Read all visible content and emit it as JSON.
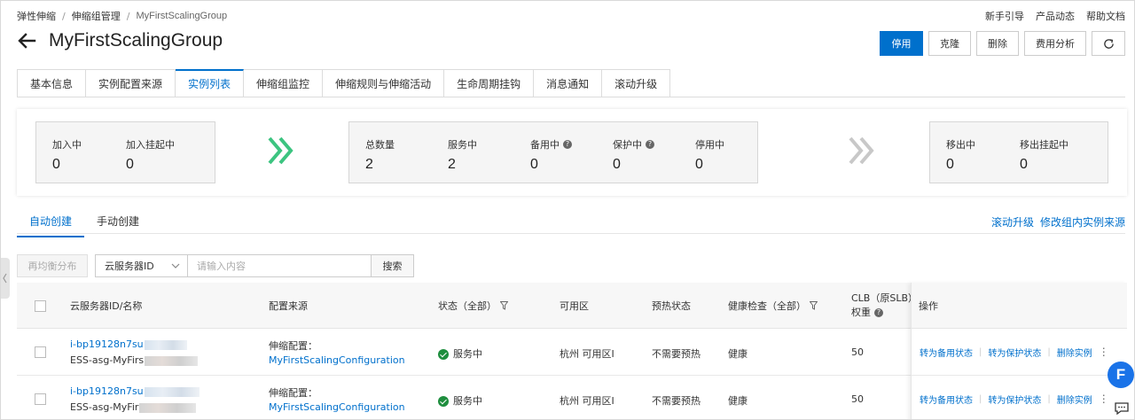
{
  "breadcrumb": [
    "弹性伸缩",
    "伸缩组管理",
    "MyFirstScalingGroup"
  ],
  "top_links": [
    "新手引导",
    "产品动态",
    "帮助文档"
  ],
  "title": "MyFirstScalingGroup",
  "actions": {
    "disable": "停用",
    "clone": "克隆",
    "delete": "删除",
    "cost": "费用分析"
  },
  "tabs": [
    "基本信息",
    "实例配置来源",
    "实例列表",
    "伸缩组监控",
    "伸缩规则与伸缩活动",
    "生命周期挂钩",
    "消息通知",
    "滚动升级"
  ],
  "active_tab": "实例列表",
  "status": {
    "joining": {
      "label": "加入中",
      "value": "0"
    },
    "joining_pending": {
      "label": "加入挂起中",
      "value": "0"
    },
    "total": {
      "label": "总数量",
      "value": "2"
    },
    "in_service": {
      "label": "服务中",
      "value": "2"
    },
    "standby": {
      "label": "备用中",
      "value": "0"
    },
    "protected": {
      "label": "保护中",
      "value": "0"
    },
    "stopped": {
      "label": "停用中",
      "value": "0"
    },
    "removing": {
      "label": "移出中",
      "value": "0"
    },
    "removing_pending": {
      "label": "移出挂起中",
      "value": "0"
    }
  },
  "subtabs": [
    "自动创建",
    "手动创建"
  ],
  "right_links": {
    "rolling": "滚动升级",
    "modify": "修改组内实例来源"
  },
  "toolbar": {
    "rebalance": "再均衡分布",
    "select_value": "云服务器ID",
    "search_placeholder": "请输入内容",
    "search": "搜索"
  },
  "table": {
    "headers": {
      "id": "云服务器ID/名称",
      "config": "配置来源",
      "status": "状态（全部）",
      "zone": "可用区",
      "warmup": "预热状态",
      "health": "健康检查（全部）",
      "clb_line1": "CLB（原SLB）",
      "clb_line2": "权重",
      "ops": "操作"
    },
    "rows": [
      {
        "id": "i-bp19128n7su",
        "name": "ESS-asg-MyFirs",
        "config_label": "伸缩配置：",
        "config_link": "MyFirstScalingConfiguration",
        "status": "服务中",
        "zone": "杭州 可用区I",
        "warmup": "不需要预热",
        "health": "健康",
        "weight": "50"
      },
      {
        "id": "i-bp19128n7su",
        "name": "ESS-asg-MyFir",
        "config_label": "伸缩配置：",
        "config_link": "MyFirstScalingConfiguration",
        "status": "服务中",
        "zone": "杭州 可用区I",
        "warmup": "不需要预热",
        "health": "健康",
        "weight": "50"
      }
    ],
    "ops": {
      "standby": "转为备用状态",
      "protect": "转为保护状态",
      "delete": "删除实例"
    }
  },
  "colors": {
    "primary": "#0070cc",
    "success": "#1e8e3e",
    "chevron_active": "#3cc480",
    "chevron_inactive": "#c8c8c8"
  },
  "float_logo": "F"
}
